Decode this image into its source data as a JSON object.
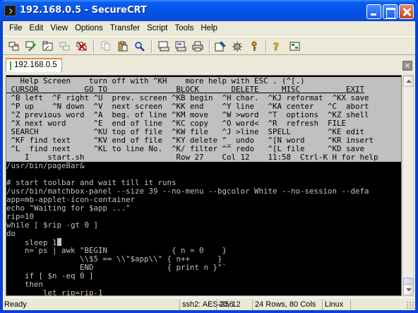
{
  "window": {
    "title": "192.168.0.5 - SecureCRT"
  },
  "menu": [
    "File",
    "Edit",
    "View",
    "Options",
    "Transfer",
    "Script",
    "Tools",
    "Help"
  ],
  "toolbar_icons": [
    "connect-icon",
    "quick-connect-icon",
    "connect-in-tab-icon",
    "reconnect-icon",
    "disconnect-icon",
    "copy-icon",
    "paste-icon",
    "find-icon",
    "print-screen-icon",
    "print-selection-icon",
    "print-icon",
    "session-options-icon",
    "global-options-icon",
    "keymap-icon",
    "help-icon",
    "sftp-icon"
  ],
  "tab": {
    "label": "192.168.0.5",
    "close": "×"
  },
  "terminal": {
    "lines": [
      {
        "text": "   Help Screen    turn off with ^KH    more help with ESC . (^[.)",
        "inverse": true
      },
      {
        "text": " CURSOR          GO TO               BLOCK       DELETE     MISC          EXIT",
        "inverse": true,
        "underline": true
      },
      {
        "text": " ^B left  ^F right ^U  prev. screen ^KB begin  ^H char.  ^KJ reformat  ^KX save",
        "inverse": true
      },
      {
        "text": " ^P up    ^N down  ^V  next screen  ^KK end    ^Y line   ^KA center   ^C  abort",
        "inverse": true
      },
      {
        "text": " ^Z previous word  ^A  beg. of line ^KM move   ^W >word  ^T  options  ^KZ shell",
        "inverse": true
      },
      {
        "text": " ^X next word      ^E  end of line  ^KC copy   ^O word<  ^R  refresh  FILE",
        "inverse": true
      },
      {
        "text": " SEARCH            ^KU top of file  ^KW file   ^J >line  SPELL        ^KE edit",
        "inverse": true
      },
      {
        "text": " ^KF find text     ^KV end of file  ^KY delete ^_ undo   ^[N word     ^KR insert",
        "inverse": true
      },
      {
        "text": " ^L  find next     ^KL to line No.  ^K/ filter ^^ redo   ^[L file     ^KD save",
        "inverse": true
      },
      {
        "text": "    I    start.sh                    Row 27    Col 12    11:58  Ctrl-K H for help",
        "inverse": true
      },
      {
        "text": "/usr/bin/pageBar&"
      },
      {
        "text": ""
      },
      {
        "text": "# start toolbar and wait till it runs"
      },
      {
        "text": "/usr/bin/matchbox-panel --size 39 --no-menu --bgcolor White --no-session --defa"
      },
      {
        "text": "app=mb-applet-icon-container"
      },
      {
        "text": "echo \"Waiting for $app ...\""
      },
      {
        "text": "rip=10"
      },
      {
        "text": "while [ $rip -gt 0 ]"
      },
      {
        "text": "do"
      },
      {
        "text": "    sleep 1",
        "cursor": true
      },
      {
        "text": "    n=`ps | awk \"BEGIN              { n = 0    }"
      },
      {
        "text": "                \\\\$5 == \\\\\"$app\\\\\" { n++      }"
      },
      {
        "text": "                END                { print n }\"`"
      },
      {
        "text": "    if [ $n -eq 0 ]"
      },
      {
        "text": "    then"
      },
      {
        "text": "        let rip=rip-1"
      }
    ]
  },
  "statusbar": {
    "ready": "Ready",
    "cipher": "ssh2: AES-256",
    "position": "20, 12",
    "size": "24 Rows, 80 Cols",
    "os": "Linux"
  }
}
